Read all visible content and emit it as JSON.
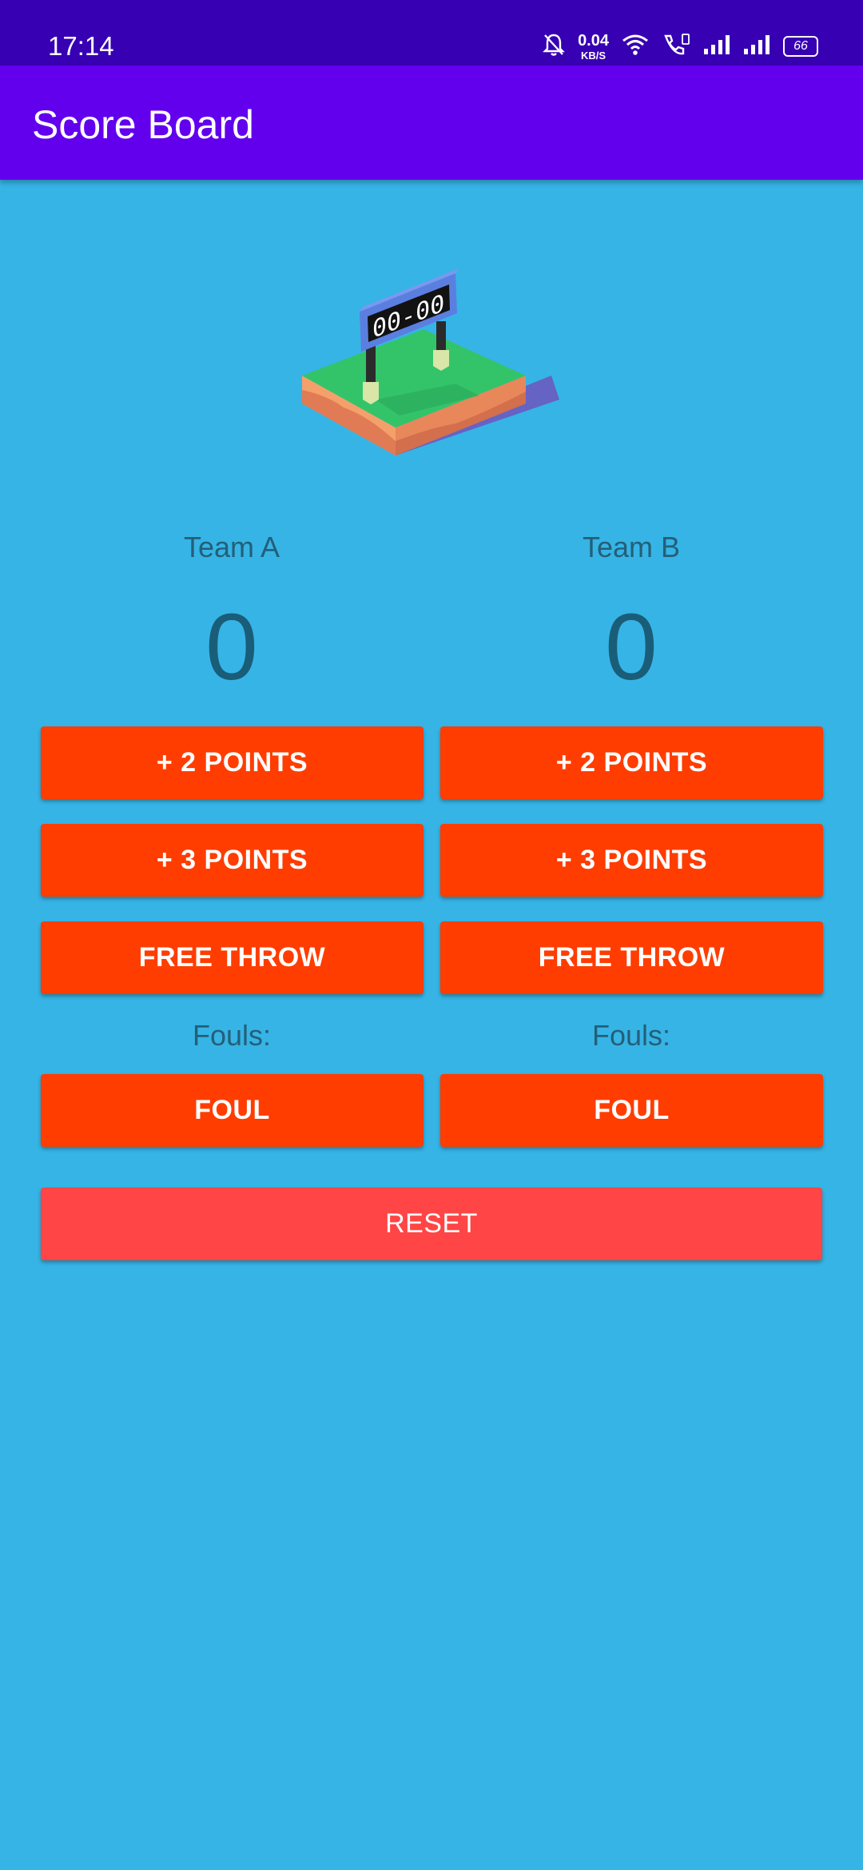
{
  "status_bar": {
    "time": "17:14",
    "net_speed_value": "0.04",
    "net_speed_unit": "KB/S",
    "battery": "66",
    "icons": [
      "bell-off-icon",
      "wifi-icon",
      "call-icon",
      "signal-icon",
      "signal-icon",
      "battery-icon"
    ]
  },
  "app_bar": {
    "title": "Score Board"
  },
  "team_a": {
    "name": "Team A",
    "score": "0",
    "fouls_label": "Fouls:",
    "buttons": {
      "plus2": "+ 2 POINTS",
      "plus3": "+ 3 POINTS",
      "free_throw": "FREE THROW",
      "foul": "FOUL"
    }
  },
  "team_b": {
    "name": "Team B",
    "score": "0",
    "fouls_label": "Fouls:",
    "buttons": {
      "plus2": "+ 2 POINTS",
      "plus3": "+ 3 POINTS",
      "free_throw": "FREE THROW",
      "foul": "FOUL"
    }
  },
  "reset_label": "RESET",
  "scoreboard_display": "00-00",
  "colors": {
    "status_bar": "#3700b3",
    "app_bar": "#6200ee",
    "background": "#36b4e6",
    "button": "#ff3d00",
    "reset_button": "#ff4545",
    "text_dark": "#1a5d78"
  }
}
